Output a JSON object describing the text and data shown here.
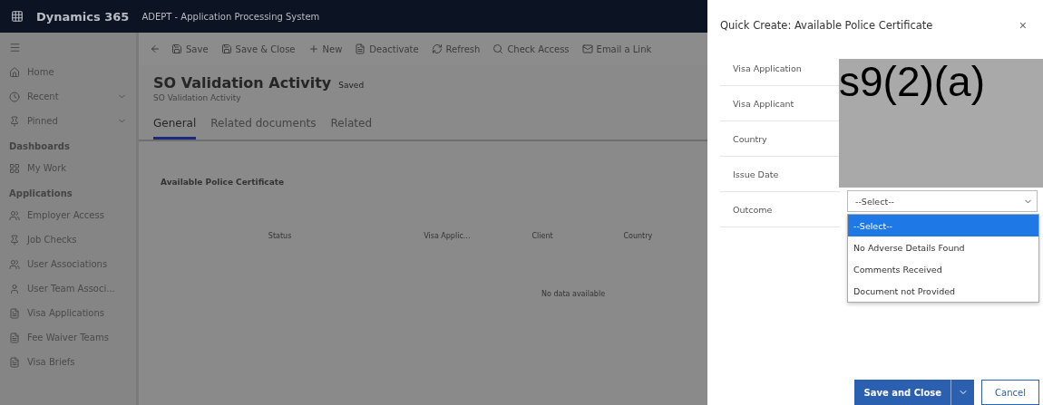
{
  "header": {
    "brand": "Dynamics 365",
    "app_name": "ADEPT - Application Processing System"
  },
  "toolbar": [
    {
      "label": "Save"
    },
    {
      "label": "Save & Close"
    },
    {
      "label": "New"
    },
    {
      "label": "Deactivate"
    },
    {
      "label": "Refresh"
    },
    {
      "label": "Check Access"
    },
    {
      "label": "Email a Link"
    }
  ],
  "sidebar": {
    "items": [
      {
        "kind": "item",
        "label": "Home"
      },
      {
        "kind": "group",
        "label": "Recent"
      },
      {
        "kind": "group",
        "label": "Pinned"
      },
      {
        "kind": "heading",
        "label": "Dashboards"
      },
      {
        "kind": "item",
        "label": "My Work"
      },
      {
        "kind": "heading",
        "label": "Applications"
      },
      {
        "kind": "item",
        "label": "Employer Access"
      },
      {
        "kind": "item",
        "label": "Job Checks"
      },
      {
        "kind": "item",
        "label": "User Associations"
      },
      {
        "kind": "item",
        "label": "User Team Associ..."
      },
      {
        "kind": "item",
        "label": "Visa Applications"
      },
      {
        "kind": "item",
        "label": "Fee Waiver Teams"
      },
      {
        "kind": "item",
        "label": "Visa Briefs"
      }
    ]
  },
  "form": {
    "title": "SO Validation Activity",
    "status": "Saved",
    "subtitle": "SO Validation Activity",
    "tabs": [
      {
        "label": "General",
        "selected": true
      },
      {
        "label": "Related documents",
        "selected": false
      },
      {
        "label": "Related",
        "selected": false
      }
    ],
    "subgrid": {
      "title": "Available Police Certificate",
      "columns": [
        "Status",
        "Visa Applic...",
        "Client",
        "Country"
      ],
      "empty_text": "No data available"
    }
  },
  "dialog": {
    "title": "Quick Create: Available Police Certificate",
    "close": "×",
    "fields": [
      {
        "label": "Visa Application"
      },
      {
        "label": "Visa Applicant"
      },
      {
        "label": "Country"
      },
      {
        "label": "Issue Date"
      }
    ],
    "redaction": "s9(2)(a)",
    "outcome": {
      "label": "Outcome",
      "value": "--Select--",
      "options": [
        {
          "label": "--Select--",
          "selected": true
        },
        {
          "label": "No Adverse Details Found",
          "selected": false
        },
        {
          "label": "Comments Received",
          "selected": false
        },
        {
          "label": "Document not Provided",
          "selected": false
        }
      ]
    },
    "primary_button": "Save and Close",
    "secondary_button": "Cancel"
  }
}
